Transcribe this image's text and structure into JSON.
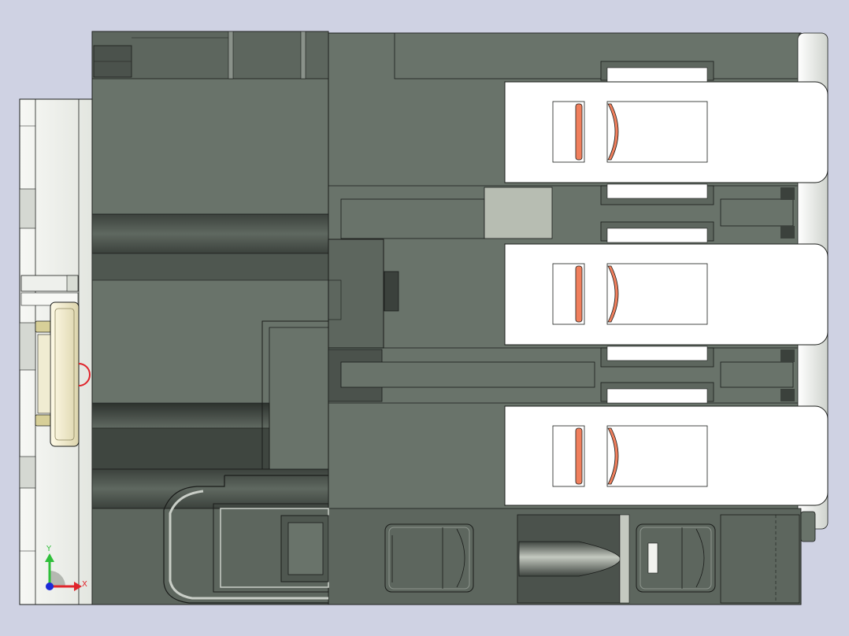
{
  "viewport": {
    "background": "#cfd2e3",
    "body_color": "#69736a",
    "body_dark": "#4b524c",
    "body_shadow": "#343a35",
    "panel_white": "#ffffff",
    "panel_light": "#eef0ec",
    "accent_orange": "#f07f5d",
    "outline": "#1a1c1a",
    "plug_light": "#b7bdb2",
    "bracket_cream": "#f4efd7"
  },
  "triad": {
    "y_label": "Y",
    "x_label": "X",
    "y_color": "#2fbf3a",
    "x_color": "#e0242b",
    "z_color": "#1b2bd8",
    "icon": "coordinate-triad-icon"
  }
}
